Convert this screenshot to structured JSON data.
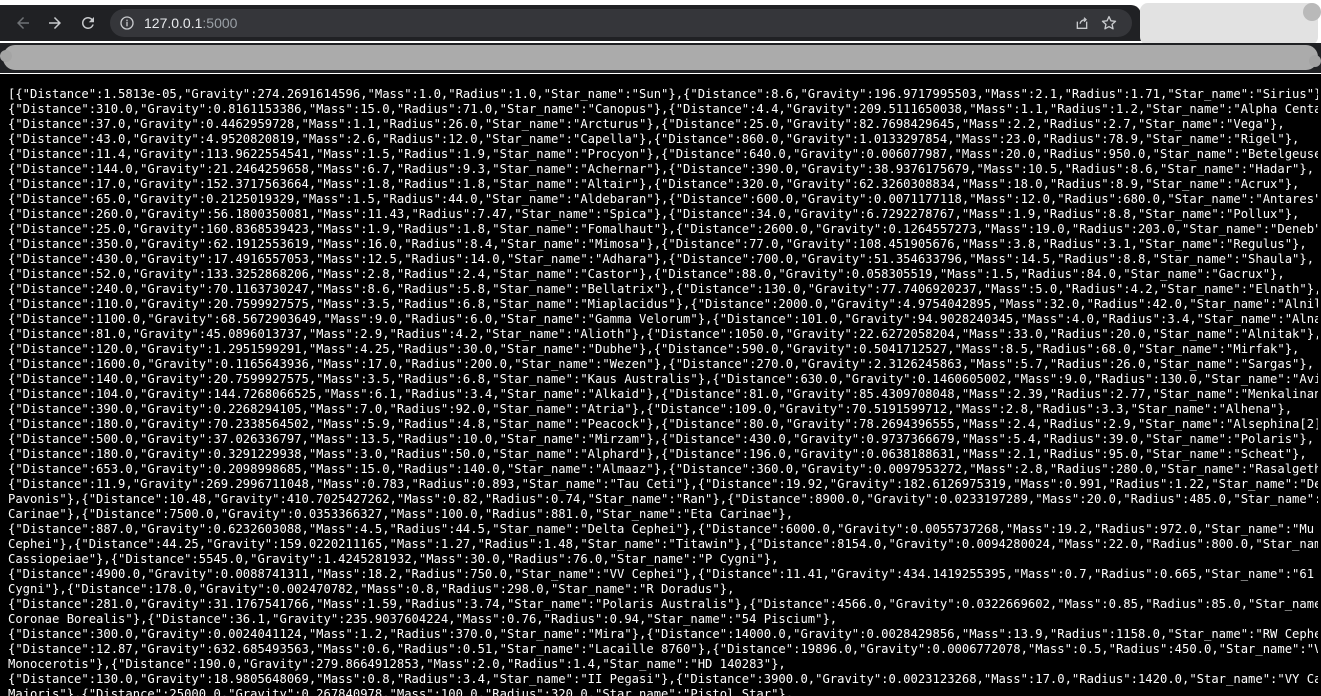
{
  "browser": {
    "url_host": "127.0.0.1",
    "url_port": ":5000",
    "back_icon": "arrow-left-icon",
    "forward_icon": "arrow-right-icon",
    "reload_icon": "reload-icon",
    "info_icon": "info-icon",
    "share_icon": "share-icon",
    "bookmark_icon": "star-icon"
  },
  "page": {
    "json_text": "[{\"Distance\":1.5813e-05,\"Gravity\":274.2691614596,\"Mass\":1.0,\"Radius\":1.0,\"Star_name\":\"Sun\"},{\"Distance\":8.6,\"Gravity\":196.9717995503,\"Mass\":2.1,\"Radius\":1.71,\"Star_name\":\"Sirius\"},\n{\"Distance\":310.0,\"Gravity\":0.8161153386,\"Mass\":15.0,\"Radius\":71.0,\"Star_name\":\"Canopus\"},{\"Distance\":4.4,\"Gravity\":209.5111650038,\"Mass\":1.1,\"Radius\":1.2,\"Star_name\":\"Alpha Centauri\"\n{\"Distance\":37.0,\"Gravity\":0.4462959728,\"Mass\":1.1,\"Radius\":26.0,\"Star_name\":\"Arcturus\"},{\"Distance\":25.0,\"Gravity\":82.7698429645,\"Mass\":2.2,\"Radius\":2.7,\"Star_name\":\"Vega\"},\n{\"Distance\":43.0,\"Gravity\":4.9520820819,\"Mass\":2.6,\"Radius\":12.0,\"Star_name\":\"Capella\"},{\"Distance\":860.0,\"Gravity\":1.0133297854,\"Mass\":23.0,\"Radius\":78.9,\"Star_name\":\"Rigel\"},\n{\"Distance\":11.4,\"Gravity\":113.9622554541,\"Mass\":1.5,\"Radius\":1.9,\"Star_name\":\"Procyon\"},{\"Distance\":640.0,\"Gravity\":0.006077987,\"Mass\":20.0,\"Radius\":950.0,\"Star_name\":\"Betelgeuse\"},\n{\"Distance\":144.0,\"Gravity\":21.2464259658,\"Mass\":6.7,\"Radius\":9.3,\"Star_name\":\"Achernar\"},{\"Distance\":390.0,\"Gravity\":38.9376175679,\"Mass\":10.5,\"Radius\":8.6,\"Star_name\":\"Hadar\"},\n{\"Distance\":17.0,\"Gravity\":152.3717563664,\"Mass\":1.8,\"Radius\":1.8,\"Star_name\":\"Altair\"},{\"Distance\":320.0,\"Gravity\":62.3260308834,\"Mass\":18.0,\"Radius\":8.9,\"Star_name\":\"Acrux\"},\n{\"Distance\":65.0,\"Gravity\":0.2125019329,\"Mass\":1.5,\"Radius\":44.0,\"Star_name\":\"Aldebaran\"},{\"Distance\":600.0,\"Gravity\":0.0071177118,\"Mass\":12.0,\"Radius\":680.0,\"Star_name\":\"Antares\"},\n{\"Distance\":260.0,\"Gravity\":56.1800350081,\"Mass\":11.43,\"Radius\":7.47,\"Star_name\":\"Spica\"},{\"Distance\":34.0,\"Gravity\":6.7292278767,\"Mass\":1.9,\"Radius\":8.8,\"Star_name\":\"Pollux\"},\n{\"Distance\":25.0,\"Gravity\":160.8368539423,\"Mass\":1.9,\"Radius\":1.8,\"Star_name\":\"Fomalhaut\"},{\"Distance\":2600.0,\"Gravity\":0.1264557273,\"Mass\":19.0,\"Radius\":203.0,\"Star_name\":\"Deneb\"},\n{\"Distance\":350.0,\"Gravity\":62.1912553619,\"Mass\":16.0,\"Radius\":8.4,\"Star_name\":\"Mimosa\"},{\"Distance\":77.0,\"Gravity\":108.451905676,\"Mass\":3.8,\"Radius\":3.1,\"Star_name\":\"Regulus\"},\n{\"Distance\":430.0,\"Gravity\":17.4916557053,\"Mass\":12.5,\"Radius\":14.0,\"Star_name\":\"Adhara\"},{\"Distance\":700.0,\"Gravity\":51.354633796,\"Mass\":14.5,\"Radius\":8.8,\"Star_name\":\"Shaula\"},\n{\"Distance\":52.0,\"Gravity\":133.3252868206,\"Mass\":2.8,\"Radius\":2.4,\"Star_name\":\"Castor\"},{\"Distance\":88.0,\"Gravity\":0.058305519,\"Mass\":1.5,\"Radius\":84.0,\"Star_name\":\"Gacrux\"},\n{\"Distance\":240.0,\"Gravity\":70.1163730247,\"Mass\":8.6,\"Radius\":5.8,\"Star_name\":\"Bellatrix\"},{\"Distance\":130.0,\"Gravity\":77.7406920237,\"Mass\":5.0,\"Radius\":4.2,\"Star_name\":\"Elnath\"},\n{\"Distance\":110.0,\"Gravity\":20.7599927575,\"Mass\":3.5,\"Radius\":6.8,\"Star_name\":\"Miaplacidus\"},{\"Distance\":2000.0,\"Gravity\":4.9754042895,\"Mass\":32.0,\"Radius\":42.0,\"Star_name\":\"Alnilam\"}\n{\"Distance\":1100.0,\"Gravity\":68.5672903649,\"Mass\":9.0,\"Radius\":6.0,\"Star_name\":\"Gamma Velorum\"},{\"Distance\":101.0,\"Gravity\":94.9028240345,\"Mass\":4.0,\"Radius\":3.4,\"Star_name\":\"Alnair\"}\n{\"Distance\":81.0,\"Gravity\":45.0896013737,\"Mass\":2.9,\"Radius\":4.2,\"Star_name\":\"Alioth\"},{\"Distance\":1050.0,\"Gravity\":22.6272058204,\"Mass\":33.0,\"Radius\":20.0,\"Star_name\":\"Alnitak\"},\n{\"Distance\":120.0,\"Gravity\":1.2951599291,\"Mass\":4.25,\"Radius\":30.0,\"Star_name\":\"Dubhe\"},{\"Distance\":590.0,\"Gravity\":0.5041712527,\"Mass\":8.5,\"Radius\":68.0,\"Star_name\":\"Mirfak\"},\n{\"Distance\":1600.0,\"Gravity\":0.1165643936,\"Mass\":17.0,\"Radius\":200.0,\"Star_name\":\"Wezen\"},{\"Distance\":270.0,\"Gravity\":2.3126245863,\"Mass\":5.7,\"Radius\":26.0,\"Star_name\":\"Sargas\"},\n{\"Distance\":140.0,\"Gravity\":20.7599927575,\"Mass\":3.5,\"Radius\":6.8,\"Star_name\":\"Kaus Australis\"},{\"Distance\":630.0,\"Gravity\":0.1460605002,\"Mass\":9.0,\"Radius\":130.0,\"Star_name\":\"Avior\"}\n{\"Distance\":104.0,\"Gravity\":144.7268066525,\"Mass\":6.1,\"Radius\":3.4,\"Star_name\":\"Alkaid\"},{\"Distance\":81.0,\"Gravity\":85.4309708048,\"Mass\":2.39,\"Radius\":2.77,\"Star_name\":\"Menkalinan\"},\n{\"Distance\":390.0,\"Gravity\":0.2268294105,\"Mass\":7.0,\"Radius\":92.0,\"Star_name\":\"Atria\"},{\"Distance\":109.0,\"Gravity\":70.5191599712,\"Mass\":2.8,\"Radius\":3.3,\"Star_name\":\"Alhena\"},\n{\"Distance\":180.0,\"Gravity\":70.2338564502,\"Mass\":5.9,\"Radius\":4.8,\"Star_name\":\"Peacock\"},{\"Distance\":80.0,\"Gravity\":78.2694396555,\"Mass\":2.4,\"Radius\":2.9,\"Star_name\":\"Alsephina[2]\"},\n{\"Distance\":500.0,\"Gravity\":37.026336797,\"Mass\":13.5,\"Radius\":10.0,\"Star_name\":\"Mirzam\"},{\"Distance\":430.0,\"Gravity\":0.9737366679,\"Mass\":5.4,\"Radius\":39.0,\"Star_name\":\"Polaris\"},\n{\"Distance\":180.0,\"Gravity\":0.3291229938,\"Mass\":3.0,\"Radius\":50.0,\"Star_name\":\"Alphard\"},{\"Distance\":196.0,\"Gravity\":0.0638188631,\"Mass\":2.1,\"Radius\":95.0,\"Star_name\":\"Scheat\"},\n{\"Distance\":653.0,\"Gravity\":0.2098998685,\"Mass\":15.0,\"Radius\":140.0,\"Star_name\":\"Almaaz\"},{\"Distance\":360.0,\"Gravity\":0.0097953272,\"Mass\":2.8,\"Radius\":280.0,\"Star_name\":\"Rasalgethi\"},\n{\"Distance\":11.9,\"Gravity\":269.2996711048,\"Mass\":0.783,\"Radius\":0.893,\"Star_name\":\"Tau Ceti\"},{\"Distance\":19.92,\"Gravity\":182.6126975319,\"Mass\":0.991,\"Radius\":1.22,\"Star_name\":\"Delta\nPavonis\"},{\"Distance\":10.48,\"Gravity\":410.7025427262,\"Mass\":0.82,\"Radius\":0.74,\"Star_name\":\"Ran\"},{\"Distance\":8900.0,\"Gravity\":0.0233197289,\"Mass\":20.0,\"Radius\":485.0,\"Star_name\":\"V38\nCarinae\"},{\"Distance\":7500.0,\"Gravity\":0.0353366327,\"Mass\":100.0,\"Radius\":881.0,\"Star_name\":\"Eta Carinae\"},\n{\"Distance\":887.0,\"Gravity\":0.6232603088,\"Mass\":4.5,\"Radius\":44.5,\"Star_name\":\"Delta Cephei\"},{\"Distance\":6000.0,\"Gravity\":0.0055737268,\"Mass\":19.2,\"Radius\":972.0,\"Star_name\":\"Mu\nCephei\"},{\"Distance\":44.25,\"Gravity\":159.0220211165,\"Mass\":1.27,\"Radius\":1.48,\"Star_name\":\"Titawin\"},{\"Distance\":8154.0,\"Gravity\":0.0094280024,\"Mass\":22.0,\"Radius\":800.0,\"Star_name\":\"\nCassiopeiae\"},{\"Distance\":5545.0,\"Gravity\":1.4245281932,\"Mass\":30.0,\"Radius\":76.0,\"Star_name\":\"P Cygni\"},\n{\"Distance\":4900.0,\"Gravity\":0.0088741311,\"Mass\":18.2,\"Radius\":750.0,\"Star_name\":\"VV Cephei\"},{\"Distance\":11.41,\"Gravity\":434.1419255395,\"Mass\":0.7,\"Radius\":0.665,\"Star_name\":\"61\nCygni\"},{\"Distance\":178.0,\"Gravity\":0.002470782,\"Mass\":0.8,\"Radius\":298.0,\"Star_name\":\"R Doradus\"},\n{\"Distance\":281.0,\"Gravity\":31.1767541766,\"Mass\":1.59,\"Radius\":3.74,\"Star_name\":\"Polaris Australis\"},{\"Distance\":4566.0,\"Gravity\":0.0322669602,\"Mass\":0.85,\"Radius\":85.0,\"Star_name\":\"R\nCoronae Borealis\"},{\"Distance\":36.1,\"Gravity\":235.9037604224,\"Mass\":0.76,\"Radius\":0.94,\"Star_name\":\"54 Piscium\"},\n{\"Distance\":300.0,\"Gravity\":0.0024041124,\"Mass\":1.2,\"Radius\":370.0,\"Star_name\":\"Mira\"},{\"Distance\":14000.0,\"Gravity\":0.0028429856,\"Mass\":13.9,\"Radius\":1158.0,\"Star_name\":\"RW Cephei\"},\n{\"Distance\":12.87,\"Gravity\":632.685493563,\"Mass\":0.6,\"Radius\":0.51,\"Star_name\":\"Lacaille 8760\"},{\"Distance\":19896.0,\"Gravity\":0.0006772078,\"Mass\":0.5,\"Radius\":450.0,\"Star_name\":\"V838\nMonocerotis\"},{\"Distance\":190.0,\"Gravity\":279.8664912853,\"Mass\":2.0,\"Radius\":1.4,\"Star_name\":\"HD 140283\"},\n{\"Distance\":130.0,\"Gravity\":18.9805648069,\"Mass\":0.8,\"Radius\":3.4,\"Star_name\":\"II Pegasi\"},{\"Distance\":3900.0,\"Gravity\":0.0023123268,\"Mass\":17.0,\"Radius\":1420.0,\"Star_name\":\"VY Canis\nMajoris\"},{\"Distance\":25000.0,\"Gravity\":0.267840978,\"Mass\":100.0,\"Radius\":320.0,\"Star_name\":\"Pistol Star\"},"
  }
}
